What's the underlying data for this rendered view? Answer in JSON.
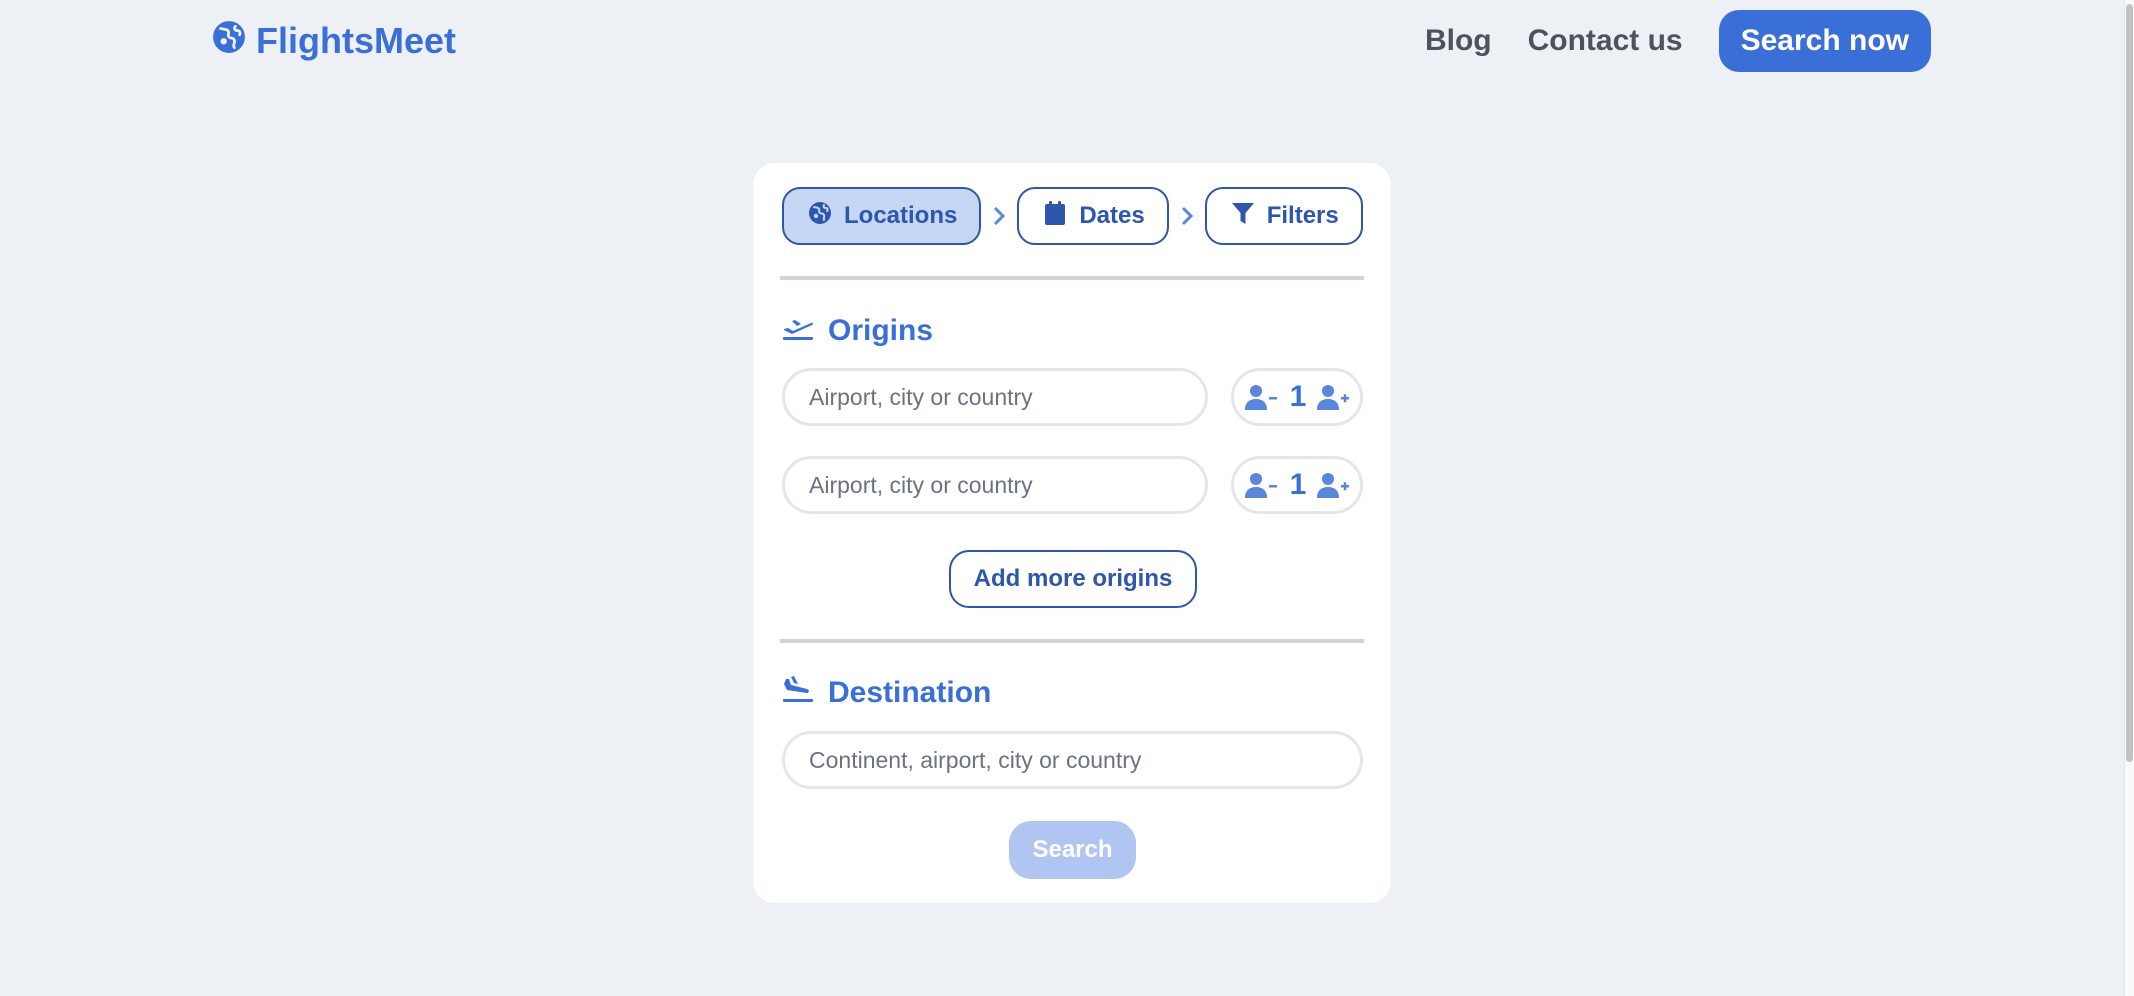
{
  "header": {
    "logo_text": "FlightsMeet",
    "logo_icon": "globe-icon",
    "nav": {
      "blog": "Blog",
      "contact": "Contact us",
      "cta": "Search now"
    }
  },
  "colors": {
    "brand": "#3a6fd8",
    "brand_dark": "#2d56ad",
    "active_step_bg": "#c5d7f5",
    "disabled_button": "#b0c5f1",
    "page_bg": "#edf1f5"
  },
  "steps": [
    {
      "label": "Locations",
      "icon": "globe-icon",
      "active": true
    },
    {
      "label": "Dates",
      "icon": "calendar-icon",
      "active": false
    },
    {
      "label": "Filters",
      "icon": "filter-icon",
      "active": false
    }
  ],
  "origins": {
    "title": "Origins",
    "icon": "plane-departure-icon",
    "rows": [
      {
        "placeholder": "Airport, city or country",
        "value": "",
        "travelers": "1"
      },
      {
        "placeholder": "Airport, city or country",
        "value": "",
        "travelers": "1"
      }
    ],
    "add_more_label": "Add more origins"
  },
  "destination": {
    "title": "Destination",
    "icon": "plane-arrival-icon",
    "placeholder": "Continent, airport, city or country",
    "value": ""
  },
  "search_label": "Search"
}
